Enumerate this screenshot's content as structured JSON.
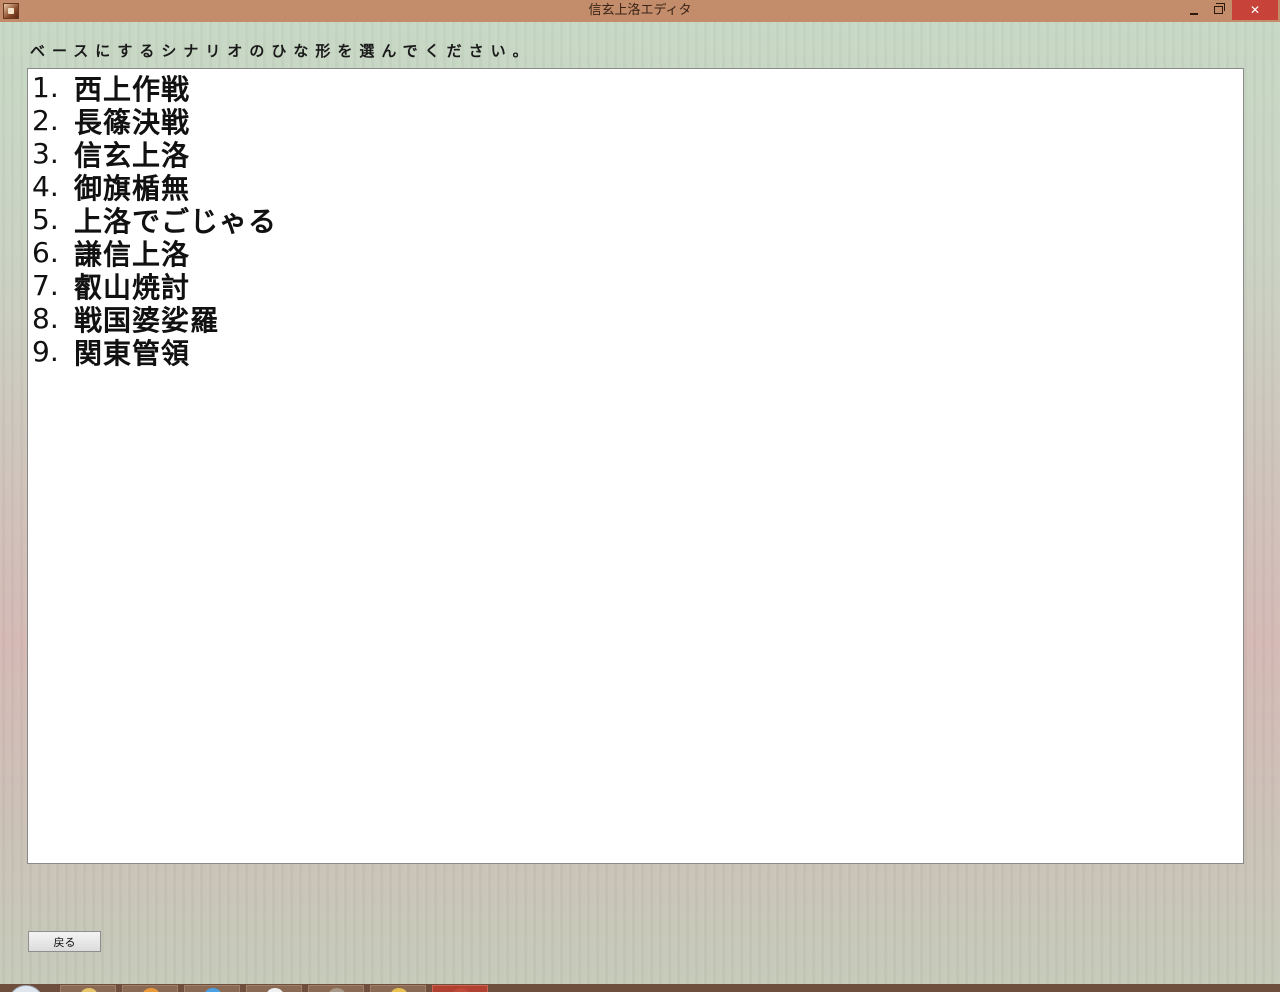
{
  "window": {
    "title": "信玄上洛エディタ",
    "minimize_label": "–",
    "maximize_label": "□",
    "close_label": "✕"
  },
  "instruction": "ベースにするシナリオのひな形を選んでください。",
  "scenarios": [
    {
      "number": "1.",
      "name": "西上作戦"
    },
    {
      "number": "2.",
      "name": "長篠決戦"
    },
    {
      "number": "3.",
      "name": "信玄上洛"
    },
    {
      "number": "4.",
      "name": "御旗楯無"
    },
    {
      "number": "5.",
      "name": "上洛でごじゃる"
    },
    {
      "number": "6.",
      "name": "謙信上洛"
    },
    {
      "number": "7.",
      "name": "叡山焼討"
    },
    {
      "number": "8.",
      "name": "戦国婆娑羅"
    },
    {
      "number": "9.",
      "name": "関東管領"
    }
  ],
  "back_button_label": "戻る",
  "colors": {
    "titlebar": "#c38c6a",
    "close_button": "#c7433a",
    "list_background": "#ffffff"
  },
  "taskbar": {
    "buttons": [
      {
        "icon": "folder-icon"
      },
      {
        "icon": "firefox-icon"
      },
      {
        "icon": "ie-icon"
      },
      {
        "icon": "chrome-icon"
      },
      {
        "icon": "window-icon"
      },
      {
        "icon": "explorer-icon"
      },
      {
        "icon": "editor-app-icon",
        "active": true
      }
    ]
  }
}
